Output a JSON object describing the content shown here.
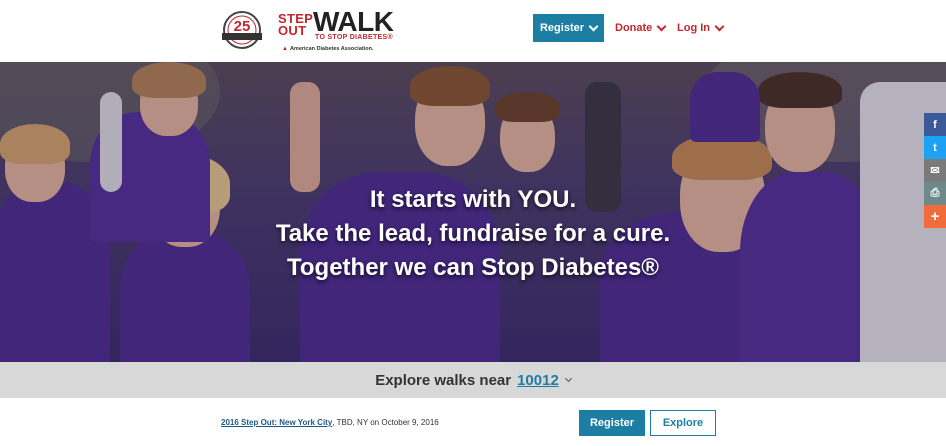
{
  "header": {
    "logo": {
      "badge_number": "25",
      "step_out": "STEP OUT",
      "walk": "WALK",
      "tagline": "TO STOP DIABETES®",
      "ada": "American Diabetes Association."
    },
    "nav": {
      "register": "Register",
      "donate": "Donate",
      "login": "Log In"
    }
  },
  "hero": {
    "line1": "It starts with YOU.",
    "line2": "Take the lead, fundraise for a cure.",
    "line3": "Together we can Stop Diabetes®"
  },
  "social": [
    {
      "icon": "facebook-icon",
      "glyph": "f",
      "color": "#3b5998"
    },
    {
      "icon": "twitter-icon",
      "glyph": "t",
      "color": "#1da1f2"
    },
    {
      "icon": "email-icon",
      "glyph": "✉",
      "color": "#7a7a7a"
    },
    {
      "icon": "print-icon",
      "glyph": "⎙",
      "color": "#6d8a8a"
    },
    {
      "icon": "plus-icon",
      "glyph": "+",
      "color": "#f26b3a"
    }
  ],
  "explore": {
    "label": "Explore walks near",
    "zip": "10012"
  },
  "walk": {
    "name": "2016 Step Out: New York City",
    "details": ", TBD, NY on October 9, 2016",
    "register": "Register",
    "explore": "Explore"
  }
}
